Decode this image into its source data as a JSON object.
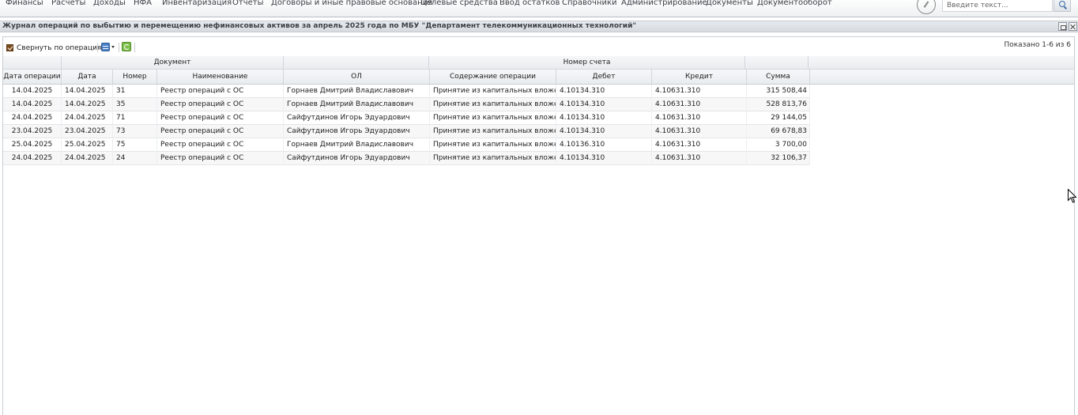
{
  "menu": {
    "items": [
      "Финансы",
      "Расчеты",
      "Доходы",
      "НФА",
      "Инвентаризация",
      "Отчеты",
      "Договоры и иные правовые основания",
      "Целевые средства",
      "Ввод остатков",
      "Справочники",
      "Администрирование",
      "Документы",
      "Документооборот"
    ],
    "search_placeholder": "Введите текст...",
    "icons": [
      "clock-icon",
      "search-icon"
    ]
  },
  "window": {
    "title": "Журнал операций по выбытию и перемещению нефинансовых активов за апрель 2025 года по МБУ \"Департамент телекоммуникационных технологий\"",
    "icons": [
      "restore-icon",
      "close-icon"
    ]
  },
  "toolbar": {
    "collapse_label": "Свернуть по операциям",
    "collapse_checked": true,
    "icons": [
      "database-icon",
      "refresh-icon"
    ],
    "shown_text": "Показано 1-6 из 6"
  },
  "grid": {
    "group_headers": {
      "document": "Документ",
      "account": "Номер счета"
    },
    "columns": [
      "Дата операции",
      "Дата",
      "Номер",
      "Наименование",
      "ОЛ",
      "Содержание операции",
      "Дебет",
      "Кредит",
      "Сумма"
    ],
    "rows": [
      [
        "14.04.2025",
        "14.04.2025",
        "31",
        "Реестр операций с ОС",
        "Горнаев Дмитрий Владиславович",
        "Принятие из капитальных вложений",
        "4.10134.310",
        "4.10631.310",
        "315 508,44"
      ],
      [
        "14.04.2025",
        "14.04.2025",
        "35",
        "Реестр операций с ОС",
        "Горнаев Дмитрий Владиславович",
        "Принятие из капитальных вложений",
        "4.10134.310",
        "4.10631.310",
        "528 813,76"
      ],
      [
        "24.04.2025",
        "24.04.2025",
        "71",
        "Реестр операций с ОС",
        "Сайфутдинов Игорь Эдуардович",
        "Принятие из капитальных вложений",
        "4.10134.310",
        "4.10631.310",
        "29 144,05"
      ],
      [
        "23.04.2025",
        "23.04.2025",
        "73",
        "Реестр операций с ОС",
        "Сайфутдинов Игорь Эдуардович",
        "Принятие из капитальных вложений",
        "4.10134.310",
        "4.10631.310",
        "69 678,83"
      ],
      [
        "25.04.2025",
        "25.04.2025",
        "75",
        "Реестр операций с ОС",
        "Горнаев Дмитрий Владиславович",
        "Принятие из капитальных вложений",
        "4.10136.310",
        "4.10631.310",
        "3 700,00"
      ],
      [
        "24.04.2025",
        "24.04.2025",
        "24",
        "Реестр операций с ОС",
        "Сайфутдинов Игорь Эдуардович",
        "Принятие из капитальных вложений",
        "4.10134.310",
        "4.10631.310",
        "32 106,37"
      ]
    ]
  },
  "colors": {
    "checkbox": "#7a4c1c",
    "header_bg": "#e9ecef",
    "border": "#c9cdd2"
  }
}
